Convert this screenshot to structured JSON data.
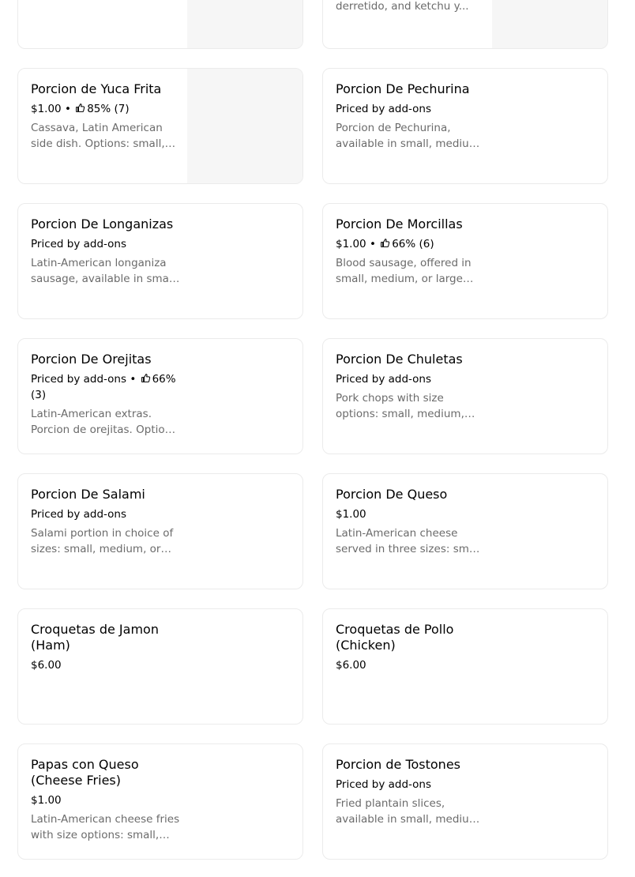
{
  "items": [
    {
      "title": "",
      "meta": "",
      "has_rating": false,
      "desc": "",
      "has_image": true
    },
    {
      "title": "",
      "meta": "",
      "has_rating": false,
      "desc": "Papas, salchichas, queso derretido, and ketchu y...",
      "has_image": true
    },
    {
      "title": "Porcion de Yuca Frita",
      "price": "$1.00",
      "rating": "85% (7)",
      "desc": "Cassava, Latin American side dish. Options: small, medium, large.",
      "has_image": true
    },
    {
      "title": "Porcion De Pechurina",
      "price": "Priced by add-ons",
      "rating": "",
      "desc": "Porcion de Pechurina, available in small, medium, or large.",
      "has_image": false
    },
    {
      "title": "Porcion De Longanizas",
      "price": "Priced by add-ons",
      "rating": "",
      "desc": "Latin-American longaniza sausage, available in small, medium or large.",
      "has_image": false
    },
    {
      "title": "Porcion De Morcillas",
      "price": "$1.00",
      "rating": "66% (6)",
      "desc": "Blood sausage, offered in small, medium, or large portions.",
      "has_image": false
    },
    {
      "title": "Porcion De Orejitas",
      "price": "Priced by add-ons",
      "rating": "66% (3)",
      "desc": "Latin-American extras. Porcion de orejitas. Options: small, medium, large.",
      "has_image": false
    },
    {
      "title": "Porcion  De Chuletas",
      "price": "Priced by add-ons",
      "rating": "",
      "desc": "Pork chops with size options: small, medium, large.",
      "has_image": false
    },
    {
      "title": "Porcion De Salami",
      "price": "Priced by add-ons",
      "rating": "",
      "desc": "Salami portion in choice of sizes: small, medium, or large.",
      "has_image": false
    },
    {
      "title": "Porcion De Queso",
      "price": "$1.00",
      "rating": "",
      "desc": "Latin-American cheese served in three sizes: small, medium, large.",
      "has_image": false
    },
    {
      "title": "Croquetas de Jamon (Ham)",
      "price": "$6.00",
      "rating": "",
      "desc": "",
      "has_image": false
    },
    {
      "title": "Croquetas de Pollo (Chicken)",
      "price": "$6.00",
      "rating": "",
      "desc": "",
      "has_image": false
    },
    {
      "title": "Papas con Queso (Cheese Fries)",
      "price": "$1.00",
      "rating": "",
      "desc": "Latin-American cheese fries with size options: small, medium, large.",
      "has_image": false
    },
    {
      "title": "Porcion de Tostones",
      "price": "Priced by add-ons",
      "rating": "",
      "desc": "Fried plantain slices, available in small, medium, or large.",
      "has_image": false
    }
  ],
  "colors": {
    "card_border": "#ebebeb",
    "muted_text": "#6b6b6b",
    "thumb_bg": "#f6f6f6"
  }
}
